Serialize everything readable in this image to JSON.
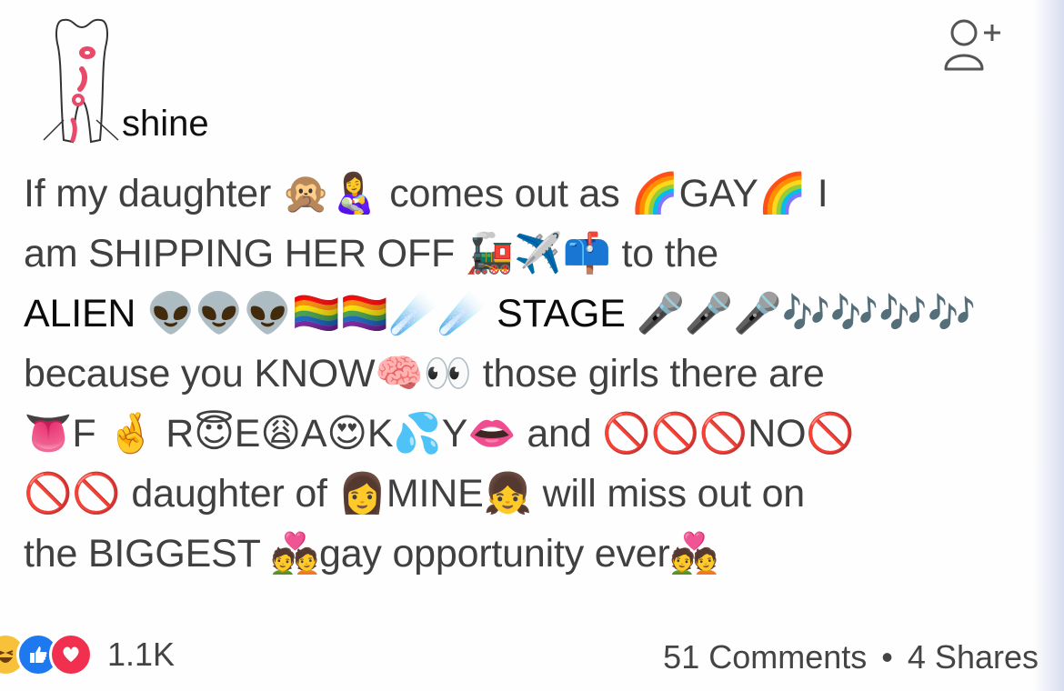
{
  "post": {
    "author": "shine",
    "lines": [
      "If my daughter 🙊👩‍🍼 comes out as 🌈GAY🌈 I",
      "am SHIPPING HER OFF 🚂✈️📫 to the",
      "ALIEN 👽👽👽🏳️‍🌈🏳️‍🌈☄️☄️ STAGE 🎤🎤🎤🎶🎶🎶🎶",
      "because you KNOW🧠👀 those girls there are",
      "👅F 🤞 R😇E😩A😍K💦Y👄 and 🚫🚫🚫NO🚫",
      "🚫🚫 daughter of 👩MINE👧 will miss out on",
      "the BIGGEST 💑gay opportunity ever💑"
    ]
  },
  "footer": {
    "reaction_icons": [
      "haha-icon",
      "like-icon",
      "love-icon"
    ],
    "reaction_count": "1.1K",
    "comments": "51 Comments",
    "separator": "•",
    "shares": "4 Shares"
  },
  "colors": {
    "like": "#1e78f0",
    "love": "#f0304e",
    "haha": "#f7c23a",
    "text": "#404040"
  }
}
